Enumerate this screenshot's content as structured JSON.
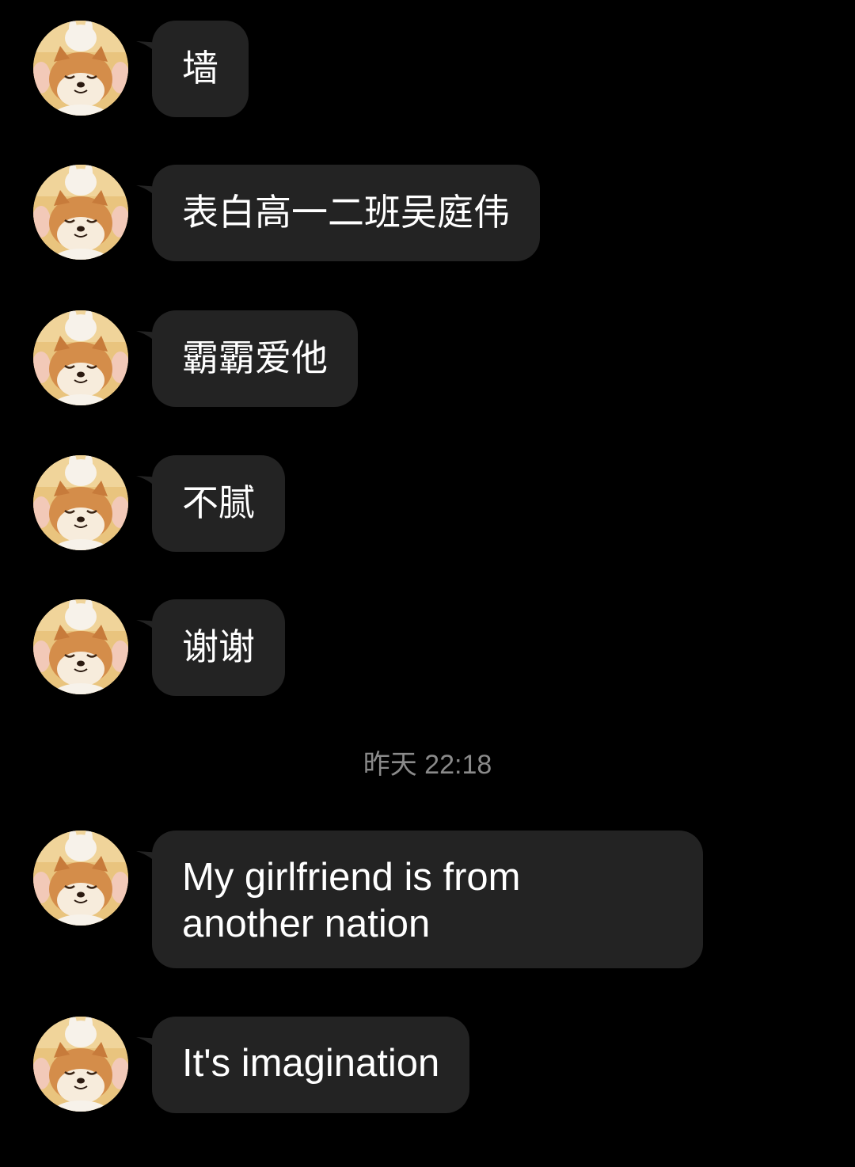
{
  "messages": [
    {
      "text": "墙",
      "avatar_icon": "shiba-dog-avatar-icon"
    },
    {
      "text": "表白高一二班吴庭伟",
      "avatar_icon": "shiba-dog-avatar-icon"
    },
    {
      "text": "霸霸爱他",
      "avatar_icon": "shiba-dog-avatar-icon"
    },
    {
      "text": "不腻",
      "avatar_icon": "shiba-dog-avatar-icon"
    },
    {
      "text": "谢谢",
      "avatar_icon": "shiba-dog-avatar-icon"
    },
    {
      "text": "My girlfriend is from\nanother nation",
      "avatar_icon": "shiba-dog-avatar-icon"
    },
    {
      "text": "It's imagination",
      "avatar_icon": "shiba-dog-avatar-icon"
    }
  ],
  "timestamp": "昨天 22:18",
  "colors": {
    "background": "#000000",
    "bubble": "#232323",
    "bubble_text": "#ffffff",
    "timestamp_text": "#8a8a8a"
  }
}
